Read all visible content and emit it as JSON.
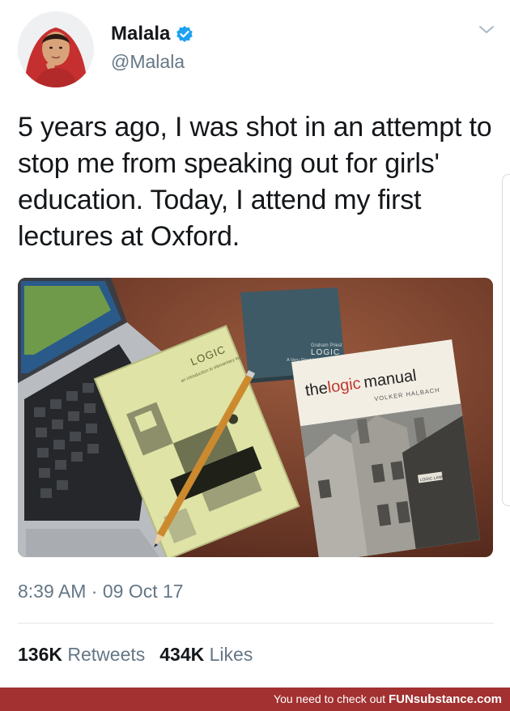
{
  "tweet": {
    "author_name": "Malala",
    "handle": "@Malala",
    "text": "5 years ago, I was shot in an attempt to stop me from speaking out for girls' education. Today, I attend my first lectures at Oxford.",
    "time": "8:39 AM",
    "separator": " · ",
    "date": "09 Oct 17"
  },
  "icons": {
    "verified": "verified-badge-icon",
    "menu": "chevron-down-icon"
  },
  "stats": {
    "retweets_count": "136K",
    "retweets_label": "Retweets",
    "likes_count": "434K",
    "likes_label": "Likes"
  },
  "photo": {
    "book1_title": "LOGIC",
    "book1_subtitle": "an introduction to elementary logic",
    "book2_title": "LOGIC",
    "book2_author": "Graham Priest",
    "book2_subtitle": "A Very Short Introduction",
    "book3_title_a": "the",
    "book3_title_b": "logic",
    "book3_title_c": "manual",
    "book3_author": "VOLKER HALBACH",
    "sign_text": "LOGIC LANE"
  },
  "footer": {
    "text": "You need to check out ",
    "brand": "FUNsubstance.com"
  },
  "colors": {
    "verified": "#1da1f2",
    "footer_bg": "#a33131",
    "secondary_text": "#657786",
    "logic_manual_accent": "#c0392b"
  }
}
